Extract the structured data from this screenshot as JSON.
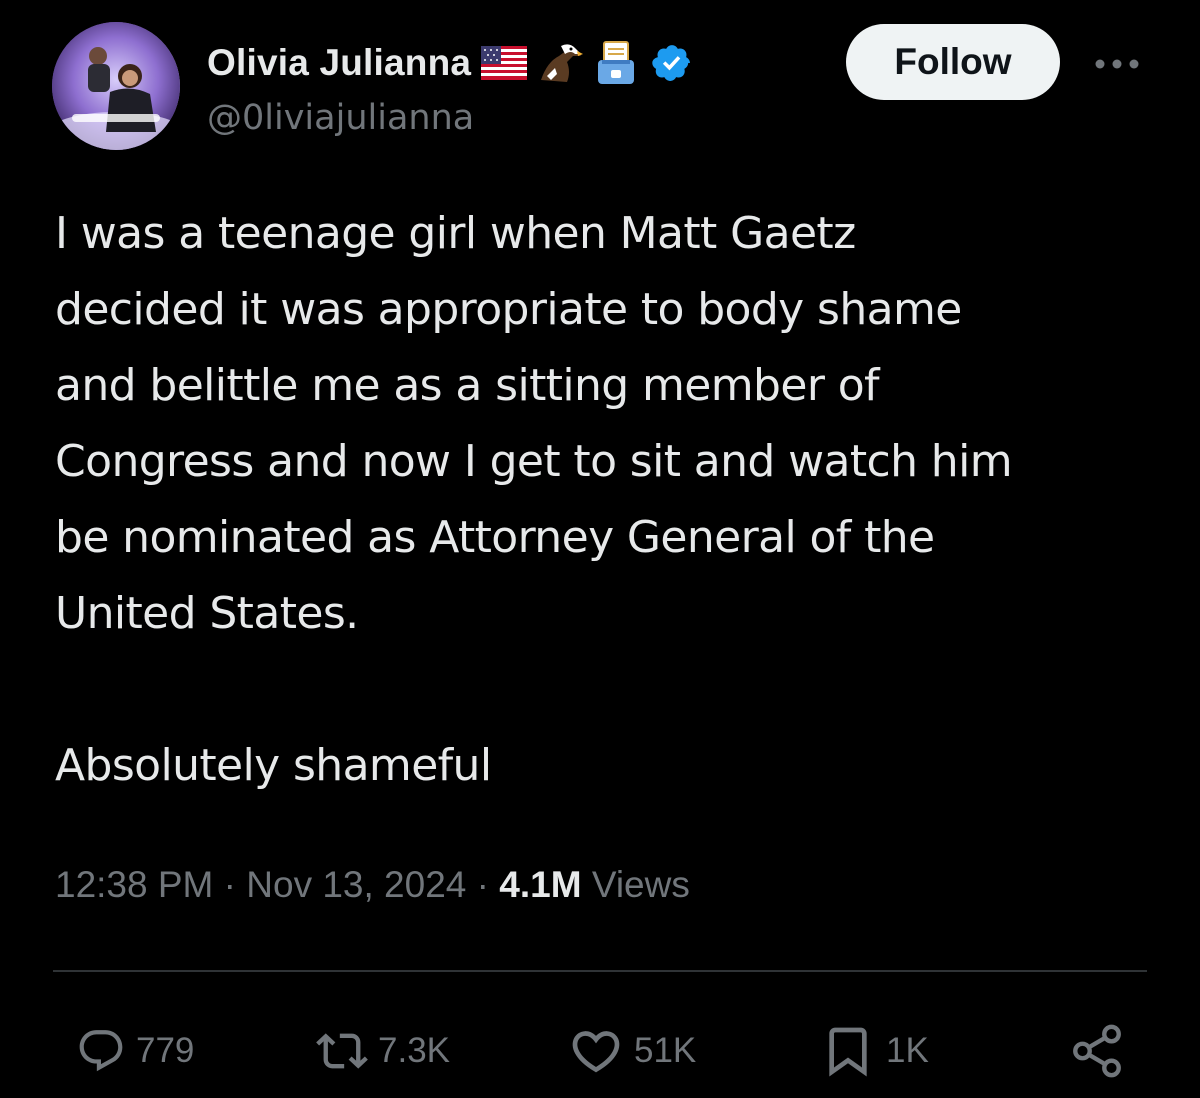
{
  "user": {
    "display_name": "Olivia Julianna",
    "handle": "@0liviajulianna",
    "badges": [
      "us-flag-icon",
      "eagle-icon",
      "ballot-box-icon",
      "verified-badge-icon"
    ]
  },
  "follow_label": "Follow",
  "tweet": {
    "text": "I was a teenage girl when Matt Gaetz\ndecided it was appropriate to body shame\nand belittle me as a sitting member of\nCongress and now I get to sit and watch him\nbe nominated as Attorney General of the\nUnited States.\n\nAbsolutely shameful",
    "time": "12:38 PM",
    "date": "Nov 13, 2024",
    "views_count": "4.1M",
    "views_label": "Views"
  },
  "actions": {
    "replies": "779",
    "reposts": "7.3K",
    "likes": "51K",
    "bookmarks": "1K"
  },
  "colors": {
    "background": "#000000",
    "text": "#e7e9ea",
    "secondary": "#71767b",
    "verified": "#1d9bf0",
    "divider": "#2f3336"
  }
}
